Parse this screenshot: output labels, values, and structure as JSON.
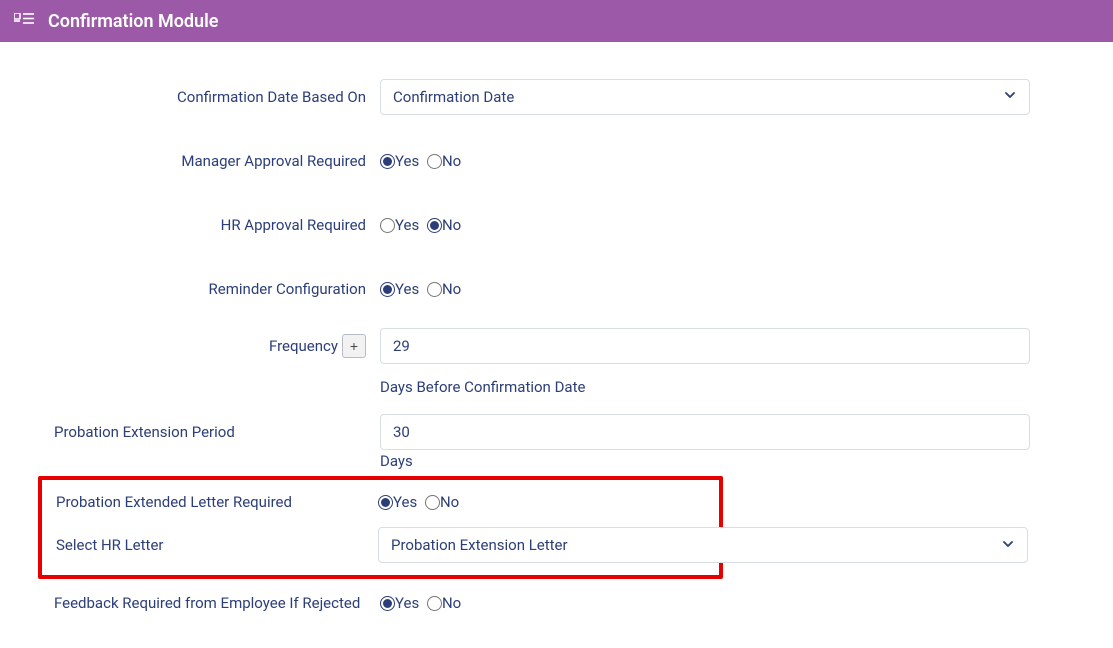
{
  "header": {
    "title": "Confirmation Module"
  },
  "fields": {
    "confirmationDateBasedOn": {
      "label": "Confirmation Date Based On",
      "value": "Confirmation Date"
    },
    "managerApproval": {
      "label": "Manager Approval Required",
      "yes": "Yes",
      "no": "No",
      "selected": "yes"
    },
    "hrApproval": {
      "label": "HR Approval Required",
      "yes": "Yes",
      "no": "No",
      "selected": "no"
    },
    "reminderConfig": {
      "label": "Reminder Configuration",
      "yes": "Yes",
      "no": "No",
      "selected": "yes"
    },
    "frequency": {
      "label": "Frequency",
      "value": "29",
      "hint": "Days Before Confirmation Date",
      "plus": "+"
    },
    "probationExtPeriod": {
      "label": "Probation Extension Period",
      "value": "30",
      "hint": "Days"
    },
    "probationExtLetter": {
      "label": "Probation Extended Letter Required",
      "yes": "Yes",
      "no": "No",
      "selected": "yes"
    },
    "selectHrLetter": {
      "label": "Select HR Letter",
      "value": "Probation Extension Letter"
    },
    "feedbackRequired": {
      "label": "Feedback Required from Employee If Rejected",
      "yes": "Yes",
      "no": "No",
      "selected": "yes"
    }
  }
}
